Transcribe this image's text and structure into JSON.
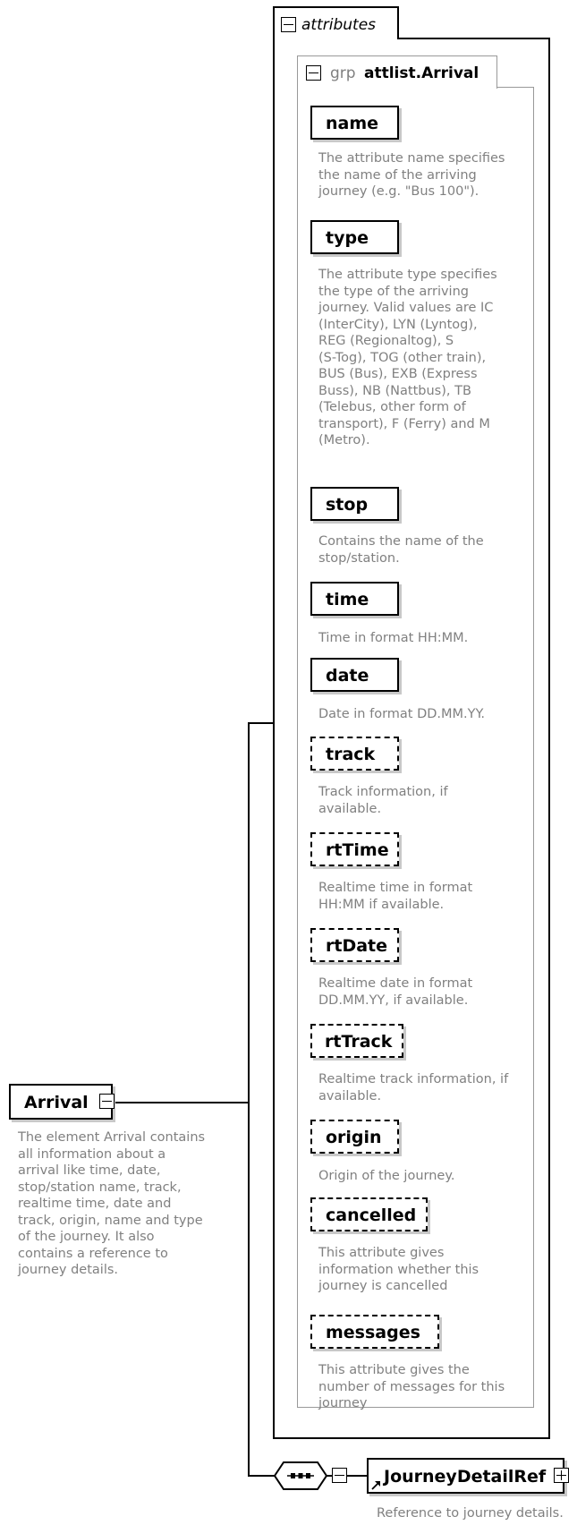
{
  "root": {
    "name": "Arrival",
    "doc": [
      "The element Arrival contains",
      "all information about a",
      "arrival like time, date,",
      "stop/station name, track,",
      "realtime time, date and",
      "track, origin, name and type",
      "of the journey. It also",
      "contains a reference to",
      "journey details."
    ]
  },
  "attributes_group": {
    "label": "attributes"
  },
  "attlist_group": {
    "prefix": "grp",
    "name": "attlist.Arrival"
  },
  "attributes": [
    {
      "name": "name",
      "optional": false,
      "doc": [
        "The attribute name specifies",
        "the name of the arriving",
        "journey (e.g. \"Bus 100\")."
      ]
    },
    {
      "name": "type",
      "optional": false,
      "doc": [
        "The attribute type specifies",
        "the type of the arriving",
        "journey. Valid values are IC",
        "(InterCity), LYN (Lyntog),",
        "REG (Regionaltog), S",
        "(S-Tog), TOG (other train),",
        "BUS (Bus), EXB (Express",
        "Buss), NB (Nattbus), TB",
        "(Telebus, other form of",
        "transport), F (Ferry) and M",
        "(Metro)."
      ]
    },
    {
      "name": "stop",
      "optional": false,
      "doc": [
        "Contains the name of the",
        "stop/station."
      ]
    },
    {
      "name": "time",
      "optional": false,
      "doc": [
        "Time in format HH:MM."
      ]
    },
    {
      "name": "date",
      "optional": false,
      "doc": [
        "Date in format DD.MM.YY."
      ]
    },
    {
      "name": "track",
      "optional": true,
      "doc": [
        "Track information, if",
        "available."
      ]
    },
    {
      "name": "rtTime",
      "optional": true,
      "doc": [
        "Realtime time in format",
        "HH:MM if available."
      ]
    },
    {
      "name": "rtDate",
      "optional": true,
      "doc": [
        "Realtime date in format",
        "DD.MM.YY, if available."
      ]
    },
    {
      "name": "rtTrack",
      "optional": true,
      "doc": [
        "Realtime track information, if",
        "available."
      ]
    },
    {
      "name": "origin",
      "optional": true,
      "doc": [
        "Origin of the journey."
      ]
    },
    {
      "name": "cancelled",
      "optional": true,
      "doc": [
        "This attribute gives",
        "information whether this",
        "journey is cancelled"
      ]
    },
    {
      "name": "messages",
      "optional": true,
      "doc": [
        "This attribute gives the",
        "number of messages for this",
        "journey"
      ]
    }
  ],
  "child": {
    "name": "JourneyDetailRef",
    "doc": [
      "Reference to journey details."
    ]
  }
}
